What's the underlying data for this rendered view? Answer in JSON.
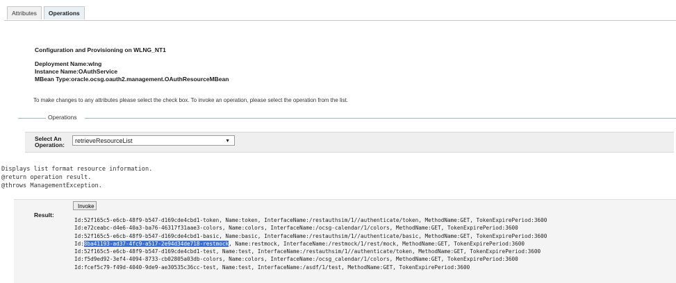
{
  "tabs": [
    {
      "label": "Attributes"
    },
    {
      "label": "Operations"
    }
  ],
  "header": {
    "title": "Configuration and Provisioning on WLNG_NT1",
    "deployment": "Deployment Name:wlng",
    "instance": "Instance Name:OAuthService",
    "mbean": "MBean Type:oracle.ocsg.oauth2.management.OAuthResourceMBean"
  },
  "hint": "To make changes to any attributes please select the check box. To invoke an operation, please select the operation from the list.",
  "operations": {
    "legend": "Operations",
    "select_label_1": "Select An",
    "select_label_2": "Operation:",
    "selected": "retrieveResourceList",
    "description_1": "Displays list format resource information.",
    "description_2": "@return operation result.",
    "description_3": "@throws ManagementException."
  },
  "result": {
    "invoke_label": "Invoke",
    "label": "Result:",
    "lines": [
      "Id:52f165c5-e6cb-48f9-b547-d169cde4cbd1-token, Name:token, InterfaceName:/restauthsim/1//authenticate/token, MethodName:GET, TokenExpirePeriod:3600",
      "Id:e72ceabc-d4e6-40a3-ba76-46317f31aae3-colors, Name:colors, InterfaceName:/ocsg-calendar/1/colors, MethodName:GET, TokenExpirePeriod:3600",
      "Id:52f165c5-e6cb-48f9-b547-d169cde4cbd1-basic, Name:basic, InterfaceName:/restauthsim/1//authenticate/basic, MethodName:GET, TokenExpirePeriod:3600",
      "Id:8ba41193-ad37-4fc9-a517-2e94d34de718-restmock, Name:restmock, InterfaceName:/restmock/1/rest/mock, MethodName:GET, TokenExpirePeriod:3600",
      "Id:52f165c5-e6cb-48f9-b547-d169cde4cbd1-test, Name:test, InterfaceName:/restauthsim/1//authenticate/token, MethodName:GET, TokenExpirePeriod:3600",
      "Id:f5d9ed92-3ef4-4094-8733-cb02805a03db-colors, Name:colors, InterfaceName:/ocsg_calendar/1/colors, MethodName:GET, TokenExpirePeriod:3600",
      "Id:fcef5c79-f49d-4040-9de9-ae30535c36cc-test, Name:test, InterfaceName:/asdf/1/test, MethodName:GET, TokenExpirePeriod:3600"
    ],
    "highlight_id": "8ba41193-ad37-4fc9-a517-2e94d34de718-restmock",
    "highlight_color": "#3a6fd8"
  }
}
